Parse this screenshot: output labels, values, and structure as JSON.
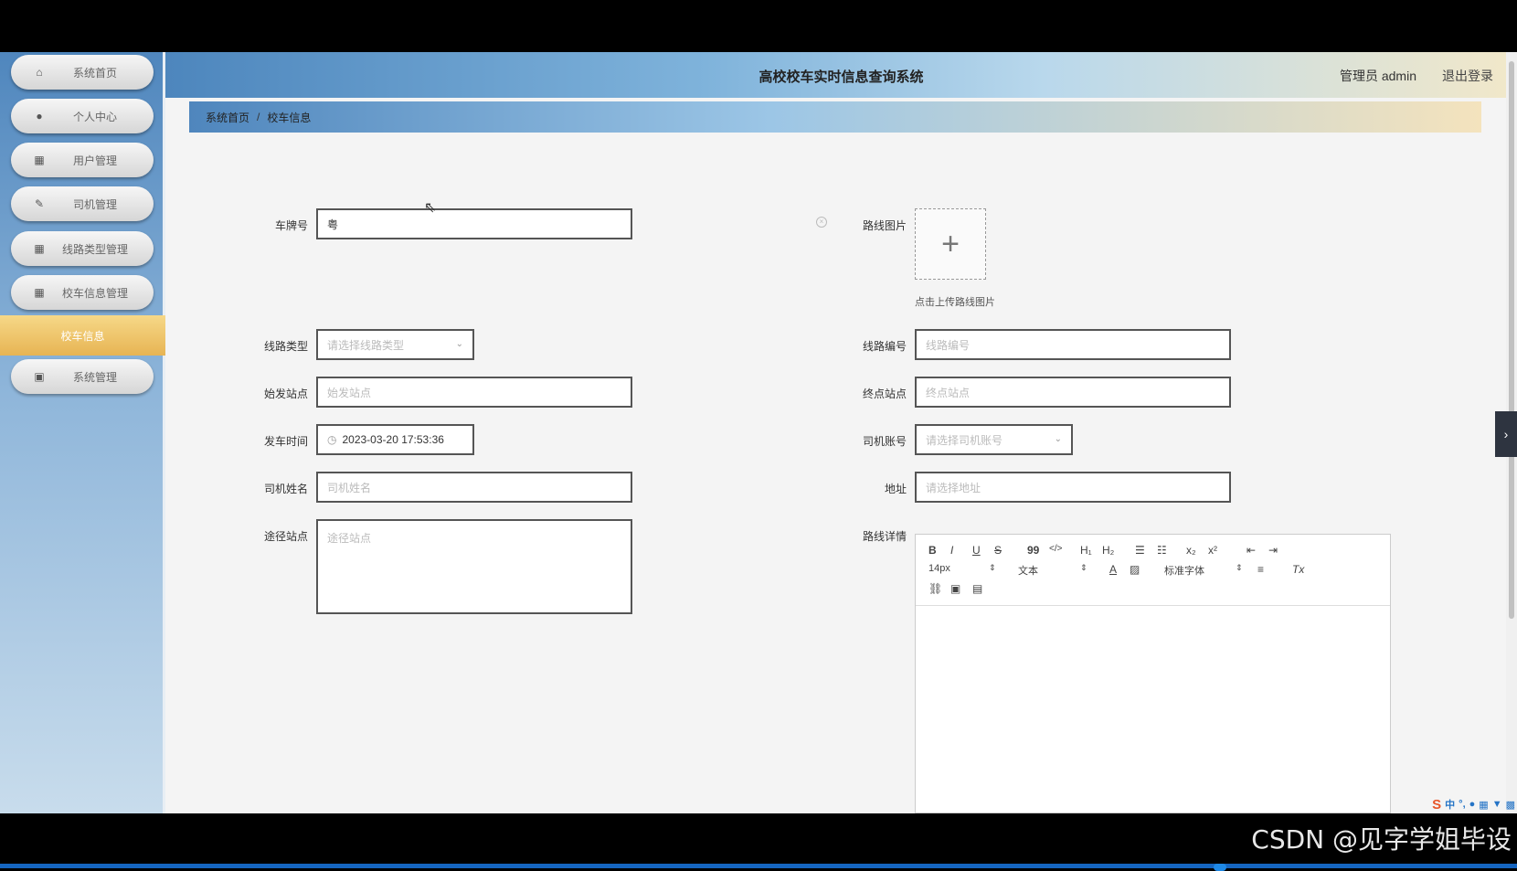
{
  "sidebar": {
    "items": [
      {
        "label": "系统首页",
        "icon": "home-icon"
      },
      {
        "label": "个人中心",
        "icon": "user-icon"
      },
      {
        "label": "用户管理",
        "icon": "grid-icon"
      },
      {
        "label": "司机管理",
        "icon": "edit-icon"
      },
      {
        "label": "线路类型管理",
        "icon": "grid-icon"
      },
      {
        "label": "校车信息管理",
        "icon": "grid-icon"
      },
      {
        "label": "系统管理",
        "icon": "settings-icon"
      }
    ],
    "active_sub": "校车信息"
  },
  "header": {
    "title": "高校校车实时信息查询系统",
    "user": "管理员 admin",
    "logout": "退出登录"
  },
  "breadcrumb": {
    "home": "系统首页",
    "separator": "/",
    "current": "校车信息"
  },
  "form": {
    "plate": {
      "label": "车牌号",
      "value": "粤"
    },
    "route_image": {
      "label": "路线图片",
      "tip": "点击上传路线图片"
    },
    "route_type": {
      "label": "线路类型",
      "placeholder": "请选择线路类型"
    },
    "route_no": {
      "label": "线路编号",
      "placeholder": "线路编号"
    },
    "start_station": {
      "label": "始发站点",
      "placeholder": "始发站点"
    },
    "end_station": {
      "label": "终点站点",
      "placeholder": "终点站点"
    },
    "depart_time": {
      "label": "发车时间",
      "value": "2023-03-20 17:53:36"
    },
    "driver_account": {
      "label": "司机账号",
      "placeholder": "请选择司机账号"
    },
    "driver_name": {
      "label": "司机姓名",
      "placeholder": "司机姓名"
    },
    "address": {
      "label": "地址",
      "placeholder": "请选择地址"
    },
    "via_stations": {
      "label": "途径站点",
      "placeholder": "途径站点"
    },
    "route_detail": {
      "label": "路线详情"
    }
  },
  "editor": {
    "font_size": "14px",
    "paragraph": "文本",
    "font_family": "标准字体",
    "buttons": {
      "bold": "B",
      "italic": "I",
      "underline": "U",
      "strike": "S",
      "quote": "99",
      "code": "</>",
      "h1": "H₁",
      "h2": "H₂",
      "sub": "x₂",
      "sup": "x²",
      "color": "A",
      "clean": "Tx"
    }
  },
  "ime": {
    "lang": "中"
  },
  "watermark": "CSDN @见字学姐毕设"
}
